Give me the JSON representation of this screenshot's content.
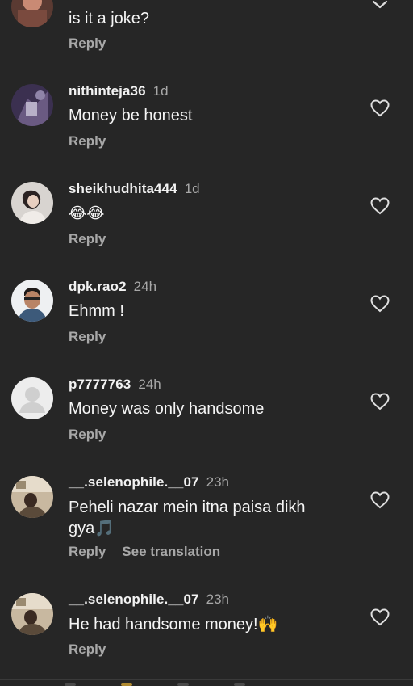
{
  "comments": [
    {
      "text": "is it a joke?",
      "reply_label": "Reply"
    },
    {
      "username": "nithinteja36",
      "time": "1d",
      "text": "Money be honest",
      "reply_label": "Reply"
    },
    {
      "username": "sheikhudhita444",
      "time": "1d",
      "text": "😂😂",
      "reply_label": "Reply"
    },
    {
      "username": "dpk.rao2",
      "time": "24h",
      "text": "Ehmm !",
      "reply_label": "Reply"
    },
    {
      "username": "p7777763",
      "time": "24h",
      "text": "Money was only handsome",
      "reply_label": "Reply"
    },
    {
      "username": "__.selenophile.__07",
      "time": "23h",
      "text": "Peheli nazar mein itna paisa dikh gya🎵",
      "reply_label": "Reply",
      "see_translation_label": "See translation"
    },
    {
      "username": "__.selenophile.__07",
      "time": "23h",
      "text": "He had handsome money!🙌",
      "reply_label": "Reply"
    }
  ],
  "icons": {
    "like": "heart-outline-icon",
    "collapse": "chevron-down-icon"
  },
  "colors": {
    "background": "#262626",
    "primary_text": "#f5f5f5",
    "secondary_text": "#a8a8a8"
  }
}
